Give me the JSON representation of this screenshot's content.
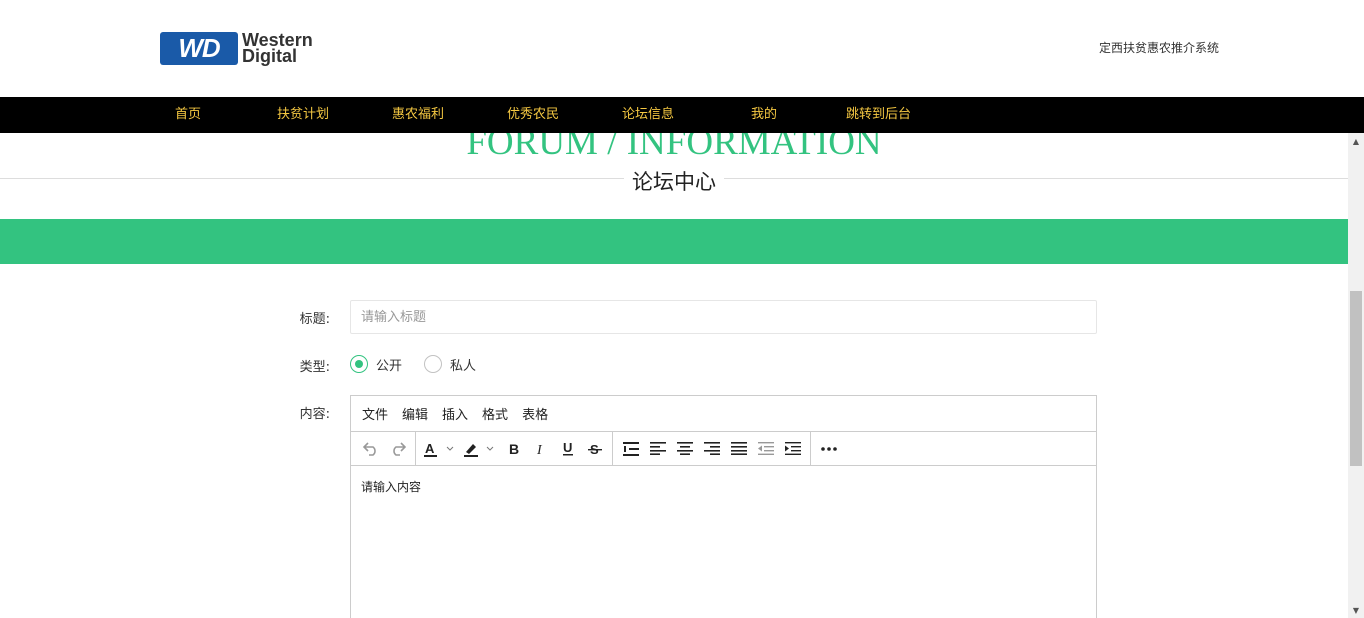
{
  "header": {
    "logo_alt": "Western Digital",
    "logo_badge": "WD",
    "logo_line1": "Western",
    "logo_line2": "Digital",
    "site_name": "定西扶贫惠农推介系统"
  },
  "nav": {
    "items": [
      {
        "label": "首页"
      },
      {
        "label": "扶贫计划"
      },
      {
        "label": "惠农福利"
      },
      {
        "label": "优秀农民"
      },
      {
        "label": "论坛信息"
      },
      {
        "label": "我的"
      },
      {
        "label": "跳转到后台"
      }
    ],
    "text_color": "#f5c842",
    "background": "#000000"
  },
  "section": {
    "title_en": "FORUM / INFORMATION",
    "title_cn": "论坛中心",
    "accent_color": "#33c380"
  },
  "form": {
    "title_label": "标题:",
    "title_placeholder": "请输入标题",
    "type_label": "类型:",
    "type_options": [
      {
        "label": "公开",
        "checked": true
      },
      {
        "label": "私人",
        "checked": false
      }
    ],
    "content_label": "内容:"
  },
  "editor": {
    "menus": [
      "文件",
      "编辑",
      "插入",
      "格式",
      "表格"
    ],
    "toolbar_icons": [
      "undo-icon",
      "redo-icon",
      "text-color-icon",
      "highlight-color-icon",
      "bold-icon",
      "italic-icon",
      "underline-icon",
      "strikethrough-icon",
      "line-height-icon",
      "align-left-icon",
      "align-center-icon",
      "align-right-icon",
      "align-justify-icon",
      "outdent-icon",
      "indent-icon",
      "more-icon"
    ],
    "content": "请输入内容"
  }
}
